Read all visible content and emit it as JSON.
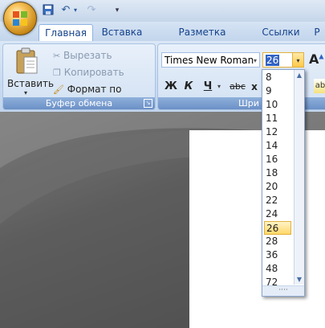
{
  "quick_access": {
    "save_icon": "save-icon",
    "undo_icon": "undo-icon",
    "redo_icon": "redo-icon",
    "customize_icon": "chevron-down-icon"
  },
  "tabs": [
    {
      "label": "Главная",
      "active": true
    },
    {
      "label": "Вставка",
      "active": false
    },
    {
      "label": "Разметка страницы",
      "active": false
    },
    {
      "label": "Ссылки",
      "active": false
    },
    {
      "label": "Р",
      "active": false
    }
  ],
  "clipboard": {
    "paste_label": "Вставить",
    "cut_label": "Вырезать",
    "copy_label": "Копировать",
    "format_painter_label": "Формат по образцу",
    "group_label": "Буфер обмена"
  },
  "font": {
    "font_name": "Times New Roman",
    "font_size": "26",
    "grow_font_label": "A",
    "bold_label": "Ж",
    "italic_label": "К",
    "underline_label": "Ч",
    "strike_label": "abc",
    "subscript_label": "x",
    "group_label": "Шри"
  },
  "size_dropdown": {
    "options": [
      "8",
      "9",
      "10",
      "11",
      "12",
      "14",
      "16",
      "18",
      "20",
      "22",
      "24",
      "26",
      "28",
      "36",
      "48",
      "72"
    ],
    "selected": "26"
  },
  "colors": {
    "ribbon_text": "#15428b",
    "selection_highlight": "#ffd86a"
  }
}
